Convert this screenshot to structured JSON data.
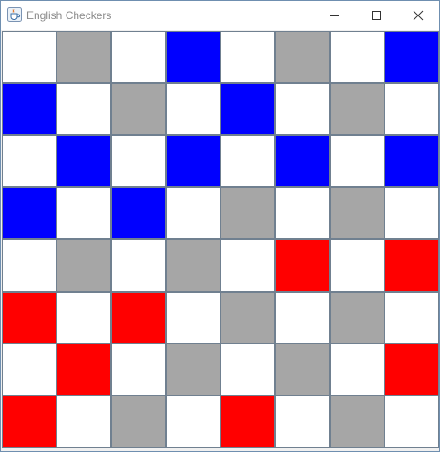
{
  "window": {
    "title": "English Checkers",
    "icon": "java-coffee-cup-icon",
    "controls": [
      "minimize-icon",
      "maximize-icon",
      "close-icon"
    ]
  },
  "colors": {
    "empty": "#ffffff",
    "dark_square": "#a6a6a6",
    "blue": "#0000ff",
    "red": "#ff0000",
    "grid_line": "#708090"
  },
  "legend": {
    "W": "empty",
    "G": "dark_square",
    "B": "blue",
    "R": "red"
  },
  "board": {
    "rows": 8,
    "cols": 8,
    "cells": [
      [
        "W",
        "G",
        "W",
        "B",
        "W",
        "G",
        "W",
        "B"
      ],
      [
        "B",
        "W",
        "G",
        "W",
        "B",
        "W",
        "G",
        "W"
      ],
      [
        "W",
        "B",
        "W",
        "B",
        "W",
        "B",
        "W",
        "B"
      ],
      [
        "B",
        "W",
        "B",
        "W",
        "G",
        "W",
        "G",
        "W"
      ],
      [
        "W",
        "G",
        "W",
        "G",
        "W",
        "R",
        "W",
        "R"
      ],
      [
        "R",
        "W",
        "R",
        "W",
        "G",
        "W",
        "G",
        "W"
      ],
      [
        "W",
        "R",
        "W",
        "G",
        "W",
        "G",
        "W",
        "R"
      ],
      [
        "R",
        "W",
        "G",
        "W",
        "R",
        "W",
        "G",
        "W"
      ]
    ]
  }
}
